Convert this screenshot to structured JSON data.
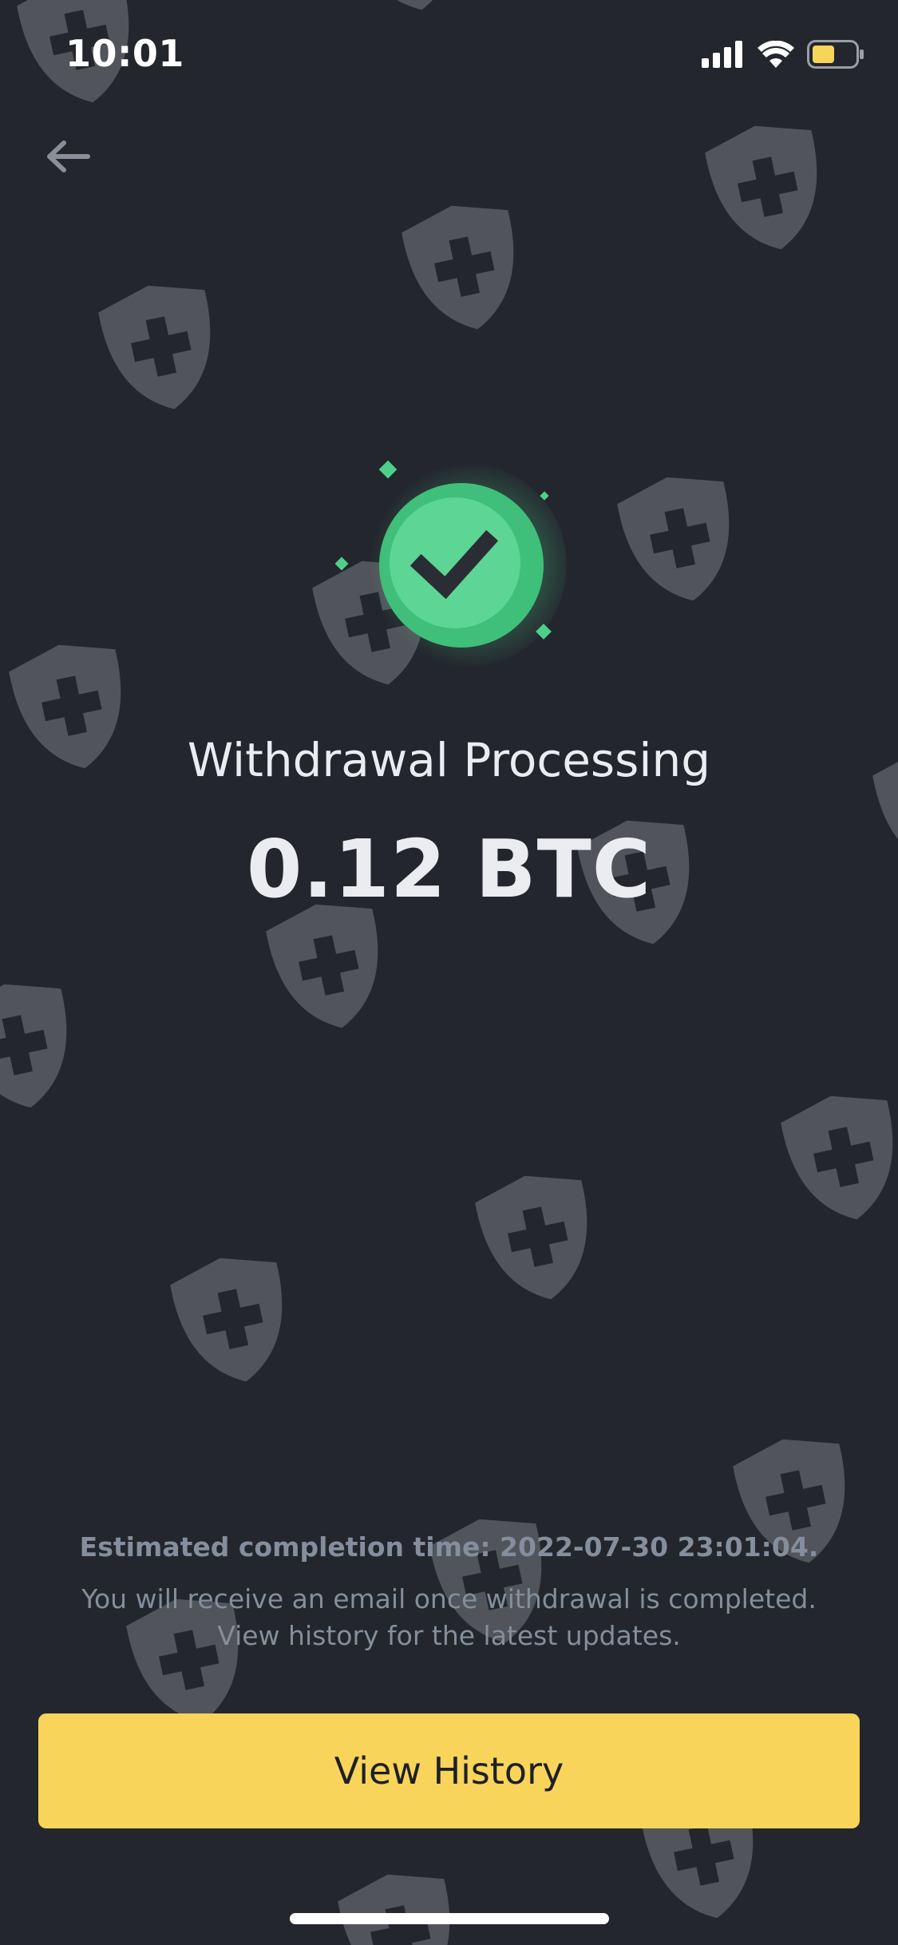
{
  "status_bar": {
    "time": "10:01",
    "icons": [
      "cellular-signal-icon",
      "wifi-icon",
      "battery-icon"
    ],
    "battery_color": "#f8d45a"
  },
  "nav": {
    "back_icon": "back-arrow-icon"
  },
  "result": {
    "status_icon": "success-check-icon",
    "status_color": "#4fd08a",
    "title": "Withdrawal Processing",
    "amount": "0.12 BTC"
  },
  "info": {
    "eta": "Estimated completion time: 2022-07-30 23:01:04.",
    "note_line1": "You will receive an email once withdrawal is completed.",
    "note_line2": "View history for the latest updates."
  },
  "actions": {
    "view_history_label": "View History",
    "button_color": "#f8d45a"
  },
  "theme": {
    "background": "#23262d",
    "watermark_icon": "shield-plus-icon"
  }
}
